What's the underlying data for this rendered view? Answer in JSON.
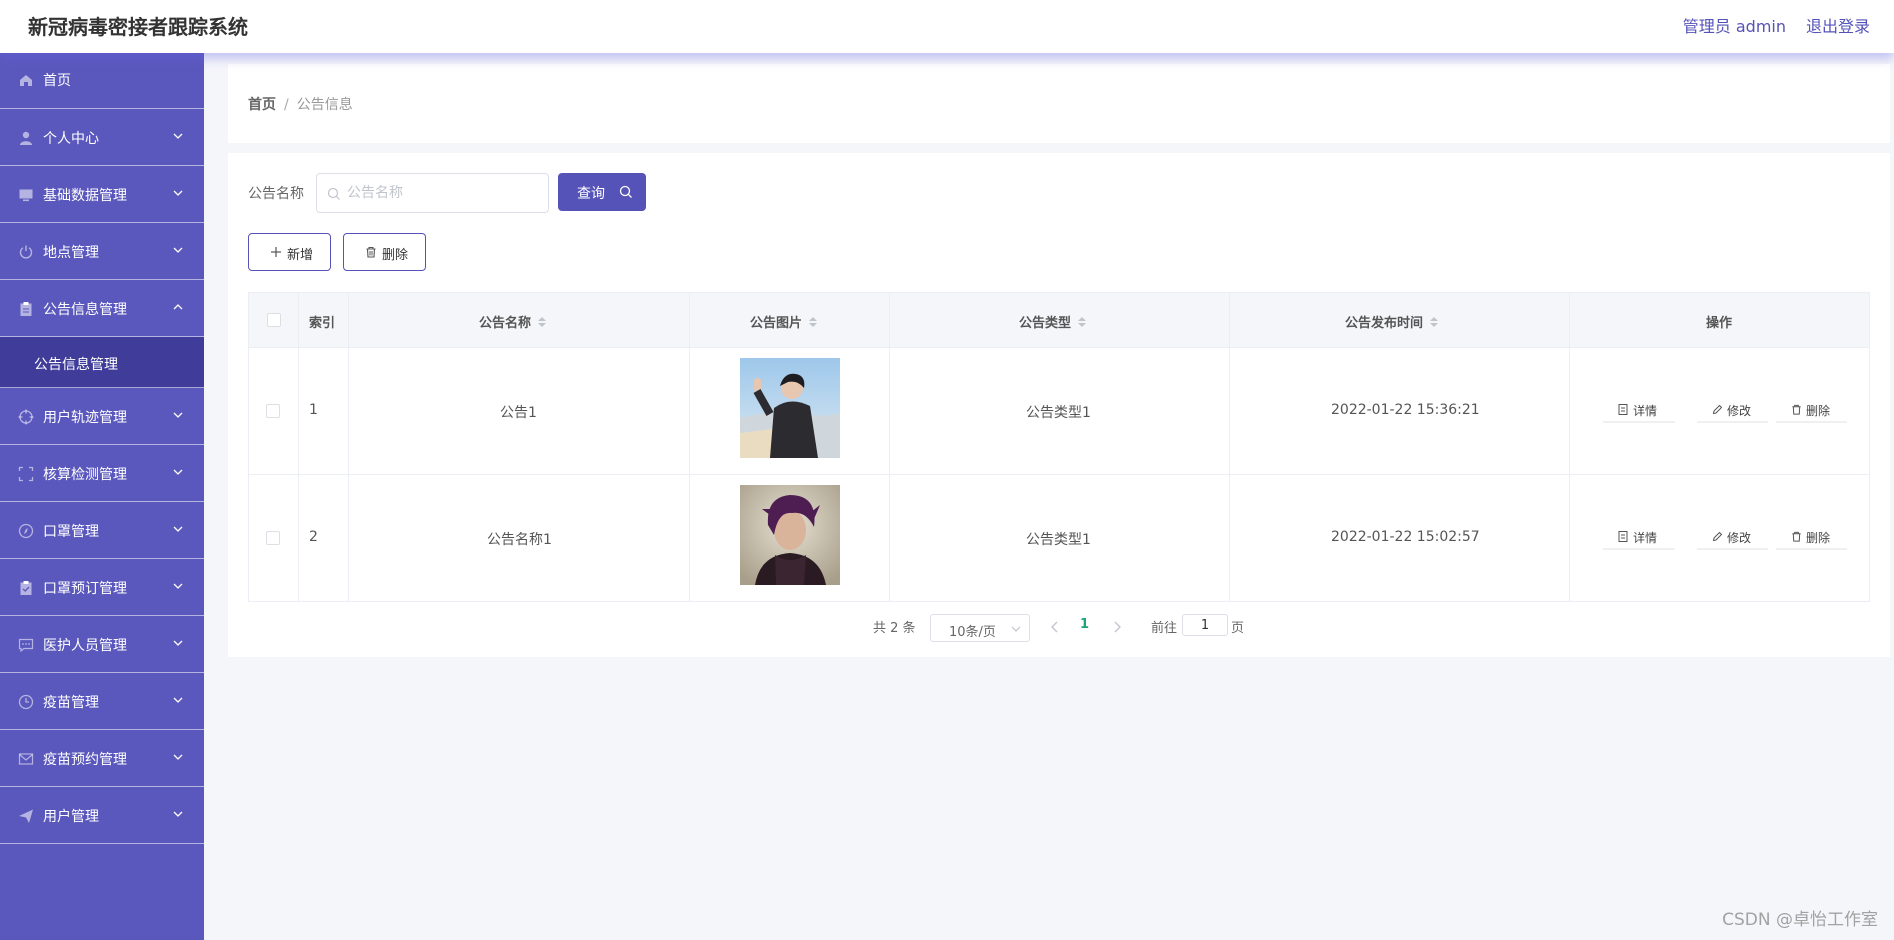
{
  "header": {
    "title": "新冠病毒密接者跟踪系统",
    "user_label": "管理员 admin",
    "logout_label": "退出登录"
  },
  "sidebar": {
    "items": [
      {
        "label": "首页",
        "icon": "home-icon"
      },
      {
        "label": "个人中心",
        "icon": "user-icon"
      },
      {
        "label": "基础数据管理",
        "icon": "monitor-icon"
      },
      {
        "label": "地点管理",
        "icon": "power-icon"
      },
      {
        "label": "公告信息管理",
        "icon": "clipboard-icon",
        "expanded": true
      },
      {
        "label": "用户轨迹管理",
        "icon": "aim-icon"
      },
      {
        "label": "核算检测管理",
        "icon": "full-screen-icon"
      },
      {
        "label": "口罩管理",
        "icon": "compass-icon"
      },
      {
        "label": "口罩预订管理",
        "icon": "clipboard-check-icon"
      },
      {
        "label": "医护人员管理",
        "icon": "chat-dot-icon"
      },
      {
        "label": "疫苗管理",
        "icon": "clock-icon"
      },
      {
        "label": "疫苗预约管理",
        "icon": "message-icon"
      },
      {
        "label": "用户管理",
        "icon": "send-icon"
      }
    ],
    "submenu_active": "公告信息管理"
  },
  "breadcrumb": {
    "home": "首页",
    "separator": "/",
    "current": "公告信息"
  },
  "search": {
    "label": "公告名称",
    "placeholder": "公告名称",
    "value": "",
    "query_button": "查询"
  },
  "toolbar": {
    "add_label": "新增",
    "delete_label": "删除"
  },
  "table": {
    "headers": {
      "index": "索引",
      "name": "公告名称",
      "image": "公告图片",
      "type": "公告类型",
      "time": "公告发布时间",
      "actions": "操作"
    },
    "rows": [
      {
        "index": "1",
        "name": "公告1",
        "image": "announcement-photo-1",
        "type": "公告类型1",
        "time": "2022-01-22 15:36:21"
      },
      {
        "index": "2",
        "name": "公告名称1",
        "image": "announcement-photo-2",
        "type": "公告类型1",
        "time": "2022-01-22 15:02:57"
      }
    ],
    "actions": {
      "detail": "详情",
      "edit": "修改",
      "delete": "删除"
    }
  },
  "pagination": {
    "total": "共 2 条",
    "page_size": "10条/页",
    "current_page": "1",
    "goto_label": "前往",
    "goto_value": "1",
    "page_suffix": "页"
  },
  "watermark": "CSDN @卓怡工作室",
  "colors": {
    "sidebar_bg": "#5b58bd",
    "sidebar_active": "#3f3c9a",
    "accent": "#5653b8",
    "pager_active": "#19a67a"
  }
}
